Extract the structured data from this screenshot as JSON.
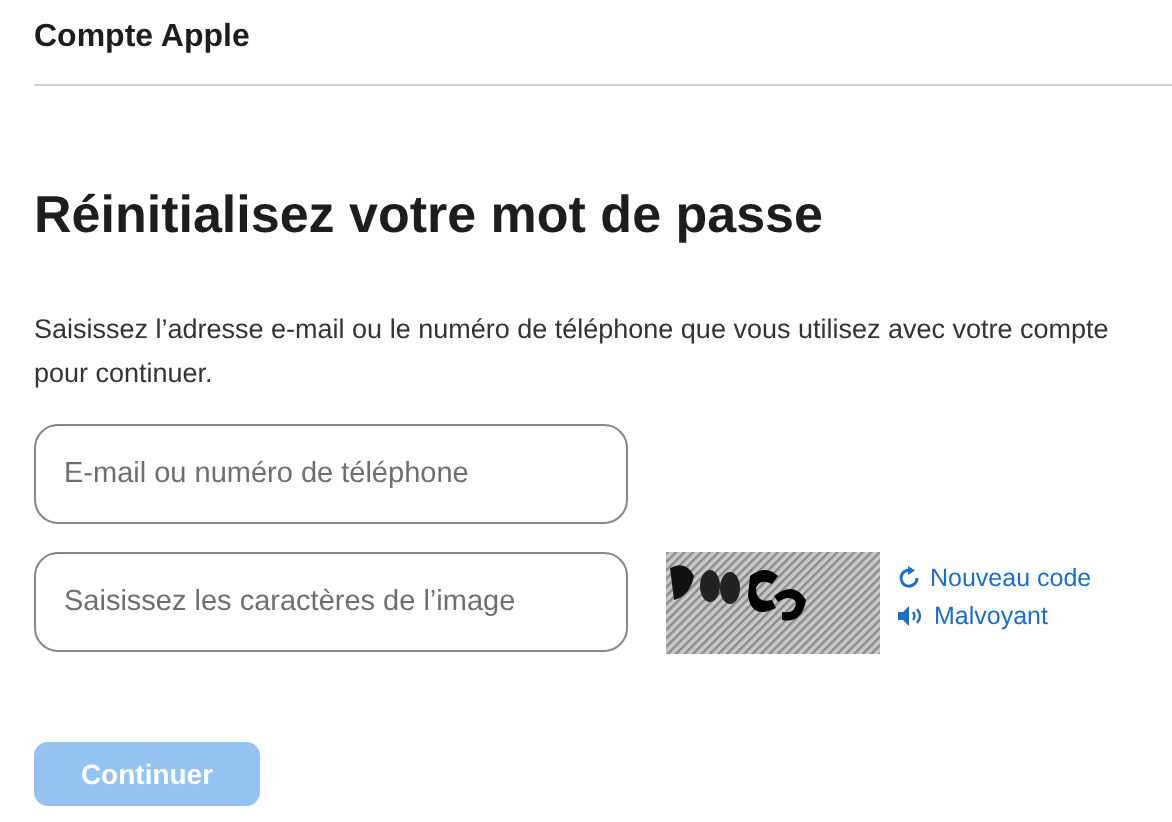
{
  "header": {
    "title": "Compte Apple"
  },
  "heading": "Réinitialisez votre mot de passe",
  "intro": "Saisissez l’adresse e-mail ou le numéro de téléphone que vous utilisez avec votre compte pour continuer.",
  "fields": [
    {
      "placeholder": "E-mail ou numéro de téléphone"
    },
    {
      "placeholder": "Saisissez les caractères de l’image"
    }
  ],
  "captcha": {
    "links": [
      {
        "kind": "refresh",
        "label": "Nouveau code"
      },
      {
        "kind": "audio",
        "label": "Malvoyant"
      }
    ]
  },
  "button": {
    "label": "Continuer",
    "disabled": true
  }
}
